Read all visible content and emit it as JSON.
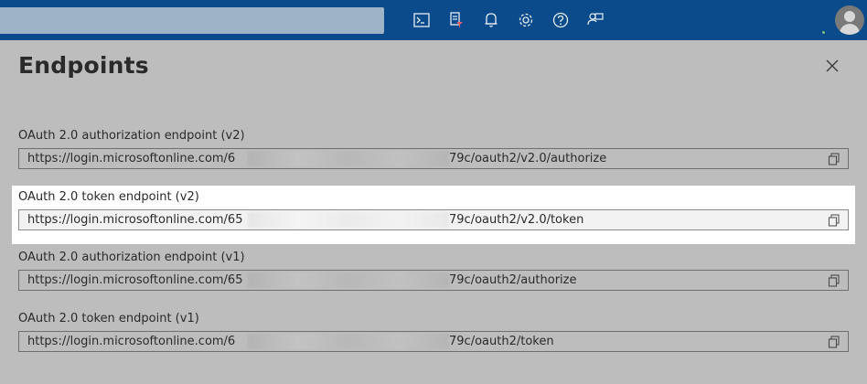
{
  "topbar": {
    "icons": [
      "cloud-shell-icon",
      "directory-filter-icon",
      "notifications-icon",
      "settings-icon",
      "help-icon",
      "feedback-icon"
    ]
  },
  "panel": {
    "title": "Endpoints",
    "close_icon": "close-icon"
  },
  "endpoints": [
    {
      "label": "OAuth 2.0 authorization endpoint (v2)",
      "url_prefix": "https://login.microsoftonline.com/6 ",
      "url_suffix": "79c/oauth2/v2.0/authorize"
    },
    {
      "label": "OAuth 2.0 token endpoint (v2)",
      "url_prefix": "https://login.microsoftonline.com/65",
      "url_suffix": "79c/oauth2/v2.0/token"
    },
    {
      "label": "OAuth 2.0 authorization endpoint (v1)",
      "url_prefix": "https://login.microsoftonline.com/65",
      "url_suffix": "79c/oauth2/authorize"
    },
    {
      "label": "OAuth 2.0 token endpoint (v1)",
      "url_prefix": "https://login.microsoftonline.com/6 ",
      "url_suffix": "79c/oauth2/token"
    }
  ],
  "colors": {
    "topbar": "#0b4a8b",
    "overlay": "#bdbdbd",
    "highlight": "#ffffff"
  }
}
